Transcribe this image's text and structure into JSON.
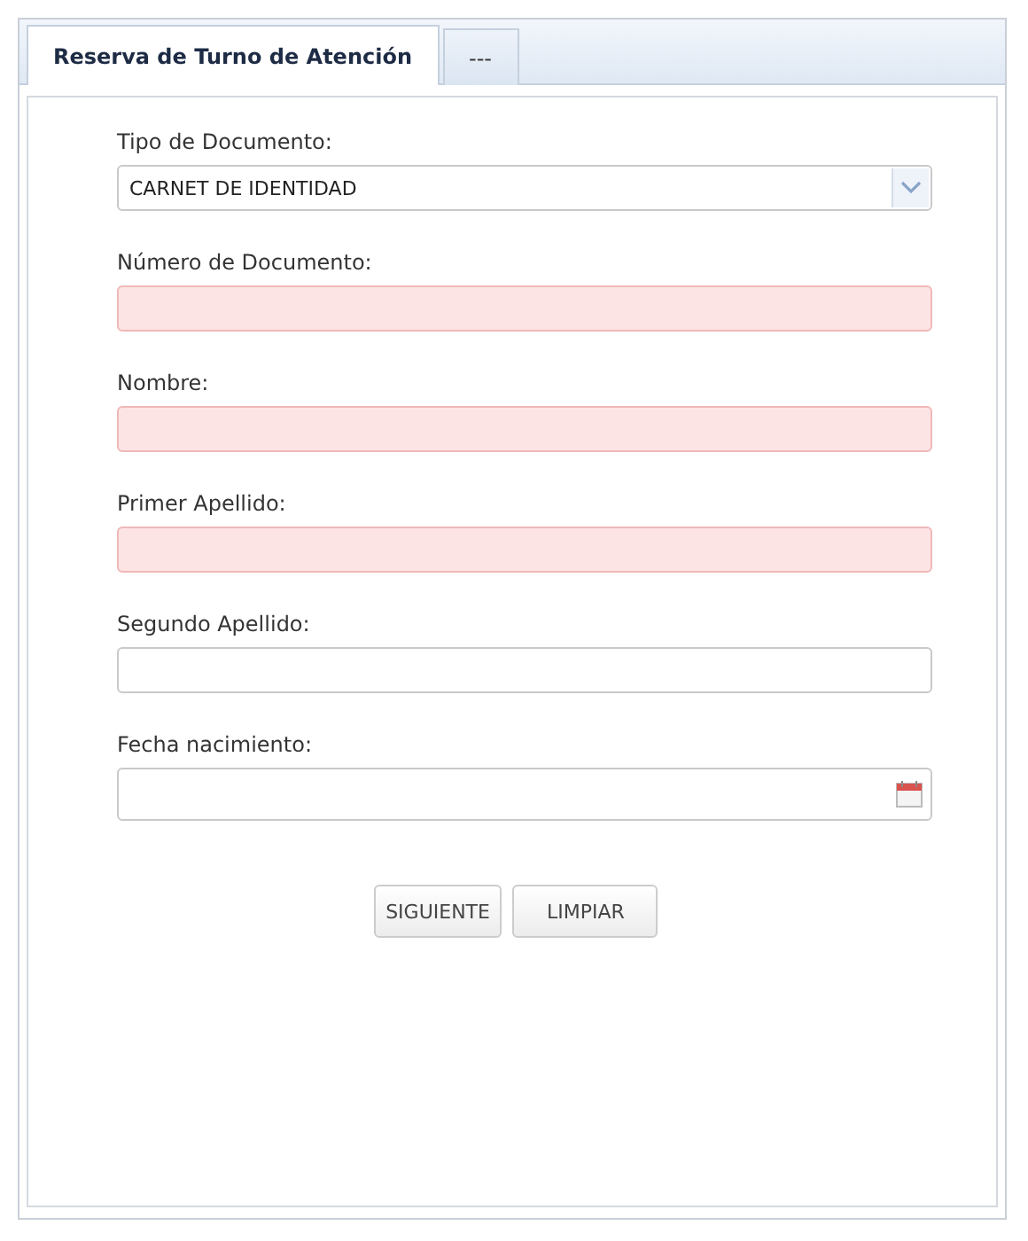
{
  "tabs": [
    {
      "label": "Reserva de Turno de Atención",
      "selected": true
    },
    {
      "label": "---",
      "selected": false
    }
  ],
  "fields": [
    {
      "kind": "select",
      "label": "Tipo de Documento:",
      "value": "CARNET DE IDENTIDAD",
      "invalid": false
    },
    {
      "kind": "text",
      "label": "Número de Documento:",
      "invalid": true
    },
    {
      "kind": "text",
      "label": "Nombre:",
      "invalid": true
    },
    {
      "kind": "text",
      "label": "Primer Apellido:",
      "invalid": true
    },
    {
      "kind": "text",
      "label": "Segundo Apellido:",
      "invalid": false
    },
    {
      "kind": "date",
      "label": "Fecha nacimiento:",
      "invalid": false
    }
  ],
  "buttons": [
    "SIGUIENTE",
    "LIMPIAR"
  ]
}
